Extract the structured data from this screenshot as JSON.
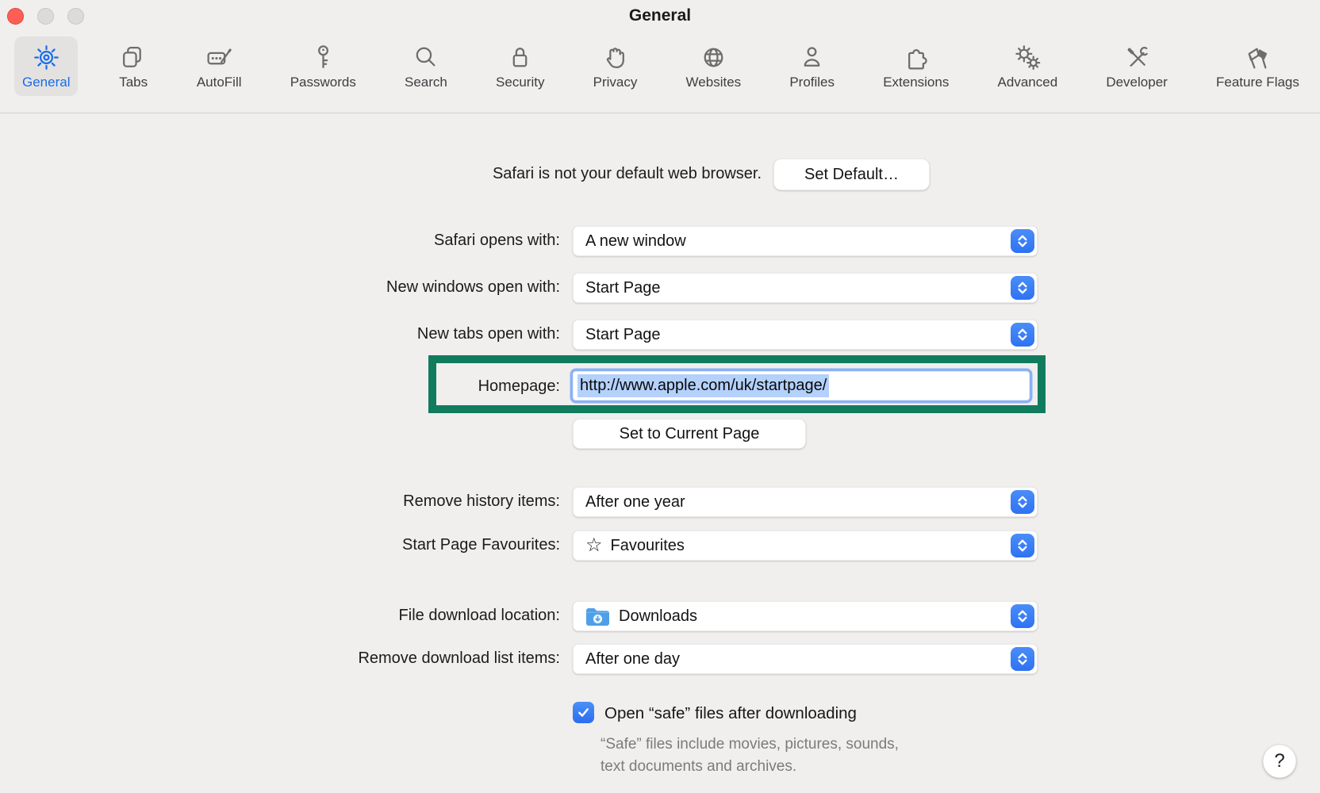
{
  "window": {
    "title": "General"
  },
  "toolbar": {
    "items": [
      {
        "label": "General",
        "icon": "gear-icon",
        "selected": true
      },
      {
        "label": "Tabs",
        "icon": "tabs-icon",
        "selected": false
      },
      {
        "label": "AutoFill",
        "icon": "autofill-icon",
        "selected": false
      },
      {
        "label": "Passwords",
        "icon": "key-icon",
        "selected": false
      },
      {
        "label": "Search",
        "icon": "magnifier-icon",
        "selected": false
      },
      {
        "label": "Security",
        "icon": "lock-icon",
        "selected": false
      },
      {
        "label": "Privacy",
        "icon": "hand-icon",
        "selected": false
      },
      {
        "label": "Websites",
        "icon": "globe-icon",
        "selected": false
      },
      {
        "label": "Profiles",
        "icon": "person-icon",
        "selected": false
      },
      {
        "label": "Extensions",
        "icon": "puzzle-icon",
        "selected": false
      },
      {
        "label": "Advanced",
        "icon": "gears-icon",
        "selected": false
      },
      {
        "label": "Developer",
        "icon": "tools-icon",
        "selected": false
      },
      {
        "label": "Feature Flags",
        "icon": "flags-icon",
        "selected": false
      }
    ]
  },
  "content": {
    "default_browser": {
      "text": "Safari is not your default web browser.",
      "button_label": "Set Default…"
    },
    "opens_with": {
      "label": "Safari opens with:",
      "value": "A new window"
    },
    "new_windows": {
      "label": "New windows open with:",
      "value": "Start Page"
    },
    "new_tabs": {
      "label": "New tabs open with:",
      "value": "Start Page"
    },
    "homepage": {
      "label": "Homepage:",
      "value": "http://www.apple.com/uk/startpage/",
      "selected": true
    },
    "set_current_label": "Set to Current Page",
    "remove_history": {
      "label": "Remove history items:",
      "value": "After one year"
    },
    "favourites": {
      "label": "Start Page Favourites:",
      "value": "Favourites",
      "icon": "star-icon"
    },
    "download_location": {
      "label": "File download location:",
      "value": "Downloads",
      "icon": "downloads-folder-icon"
    },
    "remove_downloads": {
      "label": "Remove download list items:",
      "value": "After one day"
    },
    "safe_files": {
      "label": "Open “safe” files after downloading",
      "checked": true,
      "caption_line1": "“Safe” files include movies, pictures, sounds,",
      "caption_line2": "text documents and archives."
    },
    "help_label": "?"
  },
  "colors": {
    "accent_blue": "#1a6ce8",
    "stepper_blue": "#3478f6",
    "checkbox_blue": "#2e7cf4",
    "selection_blue": "#b4d1fb",
    "annotation_green": "#117c5d",
    "close_red": "#ff5e57",
    "window_background": "#f0efee"
  }
}
